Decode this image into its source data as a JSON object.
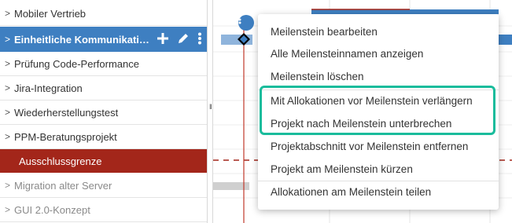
{
  "projects": [
    {
      "label": "Mobiler Vertrieb",
      "chevron": ">"
    },
    {
      "label": "Einheitliche Kommunikationsplattform",
      "chevron": ">"
    },
    {
      "label": "Prüfung Code-Performance",
      "chevron": ">"
    },
    {
      "label": "Jira-Integration",
      "chevron": ">"
    },
    {
      "label": "Wiederherstellungstest",
      "chevron": ">"
    },
    {
      "label": "PPM-Beratungsprojekt",
      "chevron": ">"
    },
    {
      "label": "Ausschlussgrenze",
      "chevron": ""
    },
    {
      "label": "Migration alter Server",
      "chevron": ">"
    },
    {
      "label": "GUI 2.0-Konzept",
      "chevron": ">"
    }
  ],
  "active_row_icons": [
    "plus-icon",
    "pencil-icon",
    "more-vertical-icon"
  ],
  "menu": {
    "items": [
      {
        "label": "Meilenstein bearbeiten"
      },
      {
        "label": "Alle Meilensteinnamen anzeigen"
      },
      {
        "label": "Meilenstein löschen"
      },
      {
        "label": "Mit Allokationen vor Meilenstein verlängern"
      },
      {
        "label": "Projekt nach Meilenstein unterbrechen"
      },
      {
        "label": "Projektabschnitt vor Meilenstein entfernen"
      },
      {
        "label": "Projekt am Meilenstein kürzen"
      },
      {
        "label": "Allokationen am Meilenstein teilen"
      }
    ]
  },
  "colors": {
    "active_row": "#3e7fc1",
    "barrier_row": "#a3261a",
    "highlight_border": "#1abc9c",
    "today_line": "#c0392b"
  }
}
